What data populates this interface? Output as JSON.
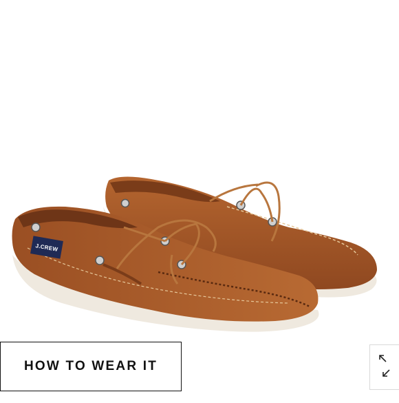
{
  "product": {
    "image_subject": "brown-boat-shoes-pair",
    "brand_tag": "J.CREW"
  },
  "overlay": {
    "how_to_wear_label": "HOW TO WEAR IT"
  },
  "controls": {
    "expand_icon": "expand-arrows-icon"
  },
  "colors": {
    "leather": "#a5582a",
    "leather_dark": "#6e3517",
    "laces": "#b8763e",
    "sole": "#f1ece3",
    "text": "#111111"
  }
}
